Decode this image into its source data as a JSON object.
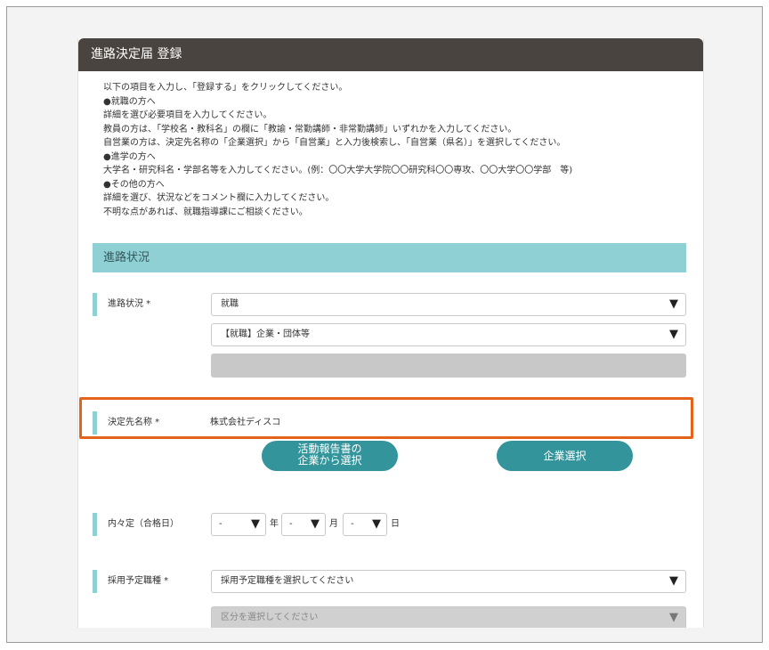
{
  "header": {
    "title": "進路決定届 登録"
  },
  "intro": {
    "lines": [
      "以下の項目を入力し、「登録する」をクリックしてください。",
      "●就職の方へ",
      "詳細を選び必要項目を入力してください。",
      "教員の方は、「学校名・教科名」の欄に「教諭・常勤講師・非常勤講師」いずれかを入力してください。",
      "自営業の方は、決定先名称の「企業選択」から「自営業」と入力後検索し、「自営業（県名）」を選択してください。",
      "●進学の方へ",
      "大学名・研究科名・学部名等を入力してください。(例：〇〇大学大学院〇〇研究科〇〇専攻、〇〇大学〇〇学部　等)",
      "●その他の方へ",
      "詳細を選び、状況などをコメント欄に入力してください。",
      "不明な点があれば、就職指導課にご相談ください。"
    ]
  },
  "section": {
    "title": "進路状況"
  },
  "fields": {
    "status_label": "進路状況 *",
    "status_value": "就職",
    "status_detail_value": "【就職】企業・団体等",
    "destination_label": "決定先名称 *",
    "destination_value": "株式会社ディスコ",
    "offer_date_label": "内々定（合格日）",
    "offer_year": "-",
    "offer_month": "-",
    "offer_day": "-",
    "year_unit": "年",
    "month_unit": "月",
    "day_unit": "日",
    "job_type_label": "採用予定職種 *",
    "job_type_placeholder": "採用予定職種を選択してください",
    "category_placeholder": "区分を選択してください"
  },
  "buttons": {
    "from_report_line1": "活動報告書の",
    "from_report_line2": "企業から選択",
    "company_select": "企業選択"
  },
  "icons": {
    "dropdown": "▼"
  },
  "colors": {
    "accent": "#33959b",
    "section": "#8fd0d5",
    "highlight": "#e4631a",
    "header": "#4a4440"
  }
}
